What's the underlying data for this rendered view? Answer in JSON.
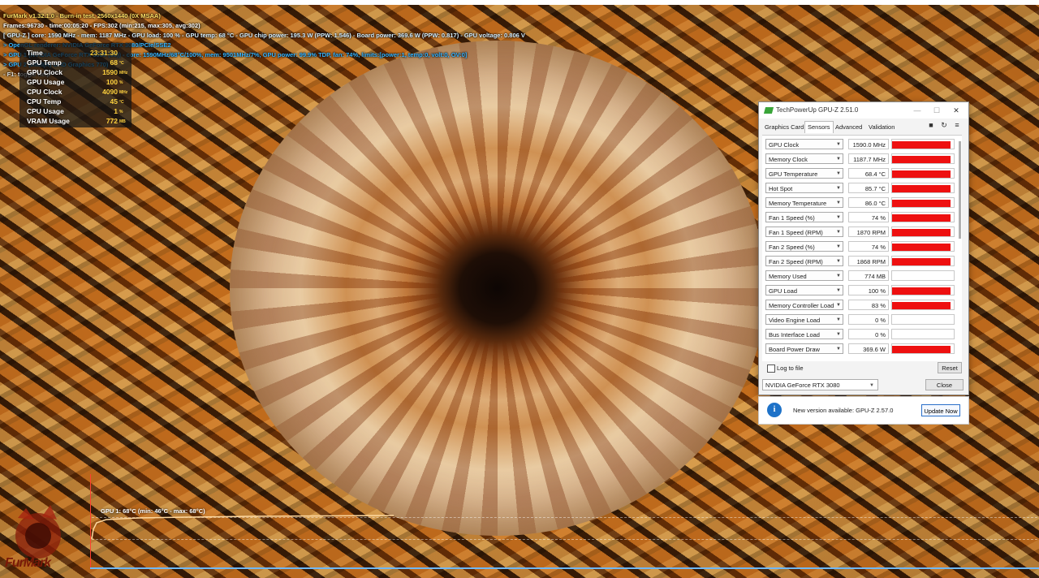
{
  "furmark": {
    "line1": "FurMark v1.32.1.0 - Burn-in test, 2560x1440 (0X MSAA)",
    "line2": "Frames:96730 - time:00:05:20 - FPS:302 (min:215, max:305, avg:302)",
    "line3": "[ GPU-Z ] core: 1590 MHz - mem: 1187 MHz - GPU load: 100 % - GPU temp: 68 °C - GPU chip power: 195.3 W (PPW: 1.546) - Board power: 369.6 W (PPW: 0.817) - GPU voltage: 0.806 V",
    "line4": "> OpenGL renderer: NVIDIA GeForce RTX 3080/PCIe/SSE2",
    "line5": "> GPU 1 (NVIDIA GeForce RTX 3080 (08)) - core: 1590MHz/68°C/100%, mem: 9501MHz/7%, GPU power: 99.9% TDP, fan: 74%, limits:[power:1, temp:0, volt:0, OV:0]",
    "line6": "> GPU 2 (Intel(R) UHD Graphics 770)",
    "line7": "- F1: toggle help"
  },
  "monitor": {
    "rows": [
      {
        "label": "Time",
        "value": "23:31:30",
        "unit": ""
      },
      {
        "label": "GPU Temp",
        "value": "68",
        "unit": "°C"
      },
      {
        "label": "GPU Clock",
        "value": "1590",
        "unit": "MHz"
      },
      {
        "label": "GPU Usage",
        "value": "100",
        "unit": "%"
      },
      {
        "label": "CPU Clock",
        "value": "4090",
        "unit": "MHz"
      },
      {
        "label": "CPU Temp",
        "value": "45",
        "unit": "°C"
      },
      {
        "label": "CPU Usage",
        "value": "1",
        "unit": "%"
      },
      {
        "label": "VRAM Usage",
        "value": "772",
        "unit": "MB"
      }
    ]
  },
  "graph": {
    "label": "GPU 1: 68°C (min: 46°C - max: 68°C)"
  },
  "logo_text": "FurMark",
  "gpuz": {
    "title": "TechPowerUp GPU-Z 2.51.0",
    "tabs": [
      "Graphics Card",
      "Sensors",
      "Advanced",
      "Validation"
    ],
    "active_tab": "Sensors",
    "sensors": [
      {
        "name": "GPU Clock",
        "value": "1590.0 MHz",
        "level": 0.95
      },
      {
        "name": "Memory Clock",
        "value": "1187.7 MHz",
        "level": 0.95
      },
      {
        "name": "GPU Temperature",
        "value": "68.4 °C",
        "level": 0.95
      },
      {
        "name": "Hot Spot",
        "value": "85.7 °C",
        "level": 0.95
      },
      {
        "name": "Memory Temperature",
        "value": "86.0 °C",
        "level": 0.95
      },
      {
        "name": "Fan 1 Speed (%)",
        "value": "74 %",
        "level": 0.95
      },
      {
        "name": "Fan 1 Speed (RPM)",
        "value": "1870 RPM",
        "level": 0.95
      },
      {
        "name": "Fan 2 Speed (%)",
        "value": "74 %",
        "level": 0.95
      },
      {
        "name": "Fan 2 Speed (RPM)",
        "value": "1868 RPM",
        "level": 0.95
      },
      {
        "name": "Memory Used",
        "value": "774 MB",
        "level": 0.0
      },
      {
        "name": "GPU Load",
        "value": "100 %",
        "level": 0.95
      },
      {
        "name": "Memory Controller Load",
        "value": "83 %",
        "level": 0.95
      },
      {
        "name": "Video Engine Load",
        "value": "0 %",
        "level": 0.0
      },
      {
        "name": "Bus Interface Load",
        "value": "0 %",
        "level": 0.0
      },
      {
        "name": "Board Power Draw",
        "value": "369.6 W",
        "level": 0.95
      }
    ],
    "log_to_file": "Log to file",
    "reset_label": "Reset",
    "selected_gpu": "NVIDIA GeForce RTX 3080",
    "close_label": "Close",
    "notify_text": "New version available: GPU-Z 2.57.0",
    "update_label": "Update Now"
  },
  "colors": {
    "bar_red": "#ee1010",
    "osd_yellow": "#ffd23f",
    "osd_blue": "#35b4ff"
  }
}
